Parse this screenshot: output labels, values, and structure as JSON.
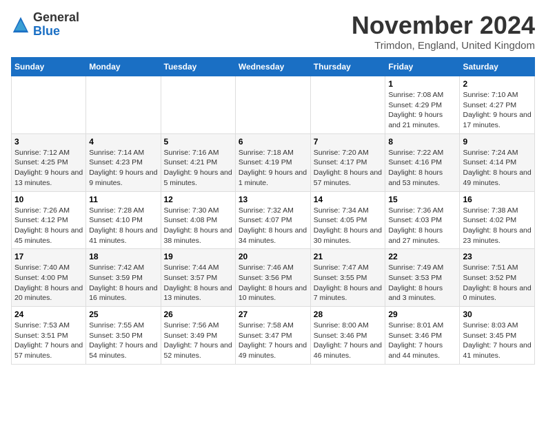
{
  "logo": {
    "general": "General",
    "blue": "Blue"
  },
  "header": {
    "month_title": "November 2024",
    "subtitle": "Trimdon, England, United Kingdom"
  },
  "days_of_week": [
    "Sunday",
    "Monday",
    "Tuesday",
    "Wednesday",
    "Thursday",
    "Friday",
    "Saturday"
  ],
  "weeks": [
    [
      {
        "day": "",
        "info": ""
      },
      {
        "day": "",
        "info": ""
      },
      {
        "day": "",
        "info": ""
      },
      {
        "day": "",
        "info": ""
      },
      {
        "day": "",
        "info": ""
      },
      {
        "day": "1",
        "info": "Sunrise: 7:08 AM\nSunset: 4:29 PM\nDaylight: 9 hours and 21 minutes."
      },
      {
        "day": "2",
        "info": "Sunrise: 7:10 AM\nSunset: 4:27 PM\nDaylight: 9 hours and 17 minutes."
      }
    ],
    [
      {
        "day": "3",
        "info": "Sunrise: 7:12 AM\nSunset: 4:25 PM\nDaylight: 9 hours and 13 minutes."
      },
      {
        "day": "4",
        "info": "Sunrise: 7:14 AM\nSunset: 4:23 PM\nDaylight: 9 hours and 9 minutes."
      },
      {
        "day": "5",
        "info": "Sunrise: 7:16 AM\nSunset: 4:21 PM\nDaylight: 9 hours and 5 minutes."
      },
      {
        "day": "6",
        "info": "Sunrise: 7:18 AM\nSunset: 4:19 PM\nDaylight: 9 hours and 1 minute."
      },
      {
        "day": "7",
        "info": "Sunrise: 7:20 AM\nSunset: 4:17 PM\nDaylight: 8 hours and 57 minutes."
      },
      {
        "day": "8",
        "info": "Sunrise: 7:22 AM\nSunset: 4:16 PM\nDaylight: 8 hours and 53 minutes."
      },
      {
        "day": "9",
        "info": "Sunrise: 7:24 AM\nSunset: 4:14 PM\nDaylight: 8 hours and 49 minutes."
      }
    ],
    [
      {
        "day": "10",
        "info": "Sunrise: 7:26 AM\nSunset: 4:12 PM\nDaylight: 8 hours and 45 minutes."
      },
      {
        "day": "11",
        "info": "Sunrise: 7:28 AM\nSunset: 4:10 PM\nDaylight: 8 hours and 41 minutes."
      },
      {
        "day": "12",
        "info": "Sunrise: 7:30 AM\nSunset: 4:08 PM\nDaylight: 8 hours and 38 minutes."
      },
      {
        "day": "13",
        "info": "Sunrise: 7:32 AM\nSunset: 4:07 PM\nDaylight: 8 hours and 34 minutes."
      },
      {
        "day": "14",
        "info": "Sunrise: 7:34 AM\nSunset: 4:05 PM\nDaylight: 8 hours and 30 minutes."
      },
      {
        "day": "15",
        "info": "Sunrise: 7:36 AM\nSunset: 4:03 PM\nDaylight: 8 hours and 27 minutes."
      },
      {
        "day": "16",
        "info": "Sunrise: 7:38 AM\nSunset: 4:02 PM\nDaylight: 8 hours and 23 minutes."
      }
    ],
    [
      {
        "day": "17",
        "info": "Sunrise: 7:40 AM\nSunset: 4:00 PM\nDaylight: 8 hours and 20 minutes."
      },
      {
        "day": "18",
        "info": "Sunrise: 7:42 AM\nSunset: 3:59 PM\nDaylight: 8 hours and 16 minutes."
      },
      {
        "day": "19",
        "info": "Sunrise: 7:44 AM\nSunset: 3:57 PM\nDaylight: 8 hours and 13 minutes."
      },
      {
        "day": "20",
        "info": "Sunrise: 7:46 AM\nSunset: 3:56 PM\nDaylight: 8 hours and 10 minutes."
      },
      {
        "day": "21",
        "info": "Sunrise: 7:47 AM\nSunset: 3:55 PM\nDaylight: 8 hours and 7 minutes."
      },
      {
        "day": "22",
        "info": "Sunrise: 7:49 AM\nSunset: 3:53 PM\nDaylight: 8 hours and 3 minutes."
      },
      {
        "day": "23",
        "info": "Sunrise: 7:51 AM\nSunset: 3:52 PM\nDaylight: 8 hours and 0 minutes."
      }
    ],
    [
      {
        "day": "24",
        "info": "Sunrise: 7:53 AM\nSunset: 3:51 PM\nDaylight: 7 hours and 57 minutes."
      },
      {
        "day": "25",
        "info": "Sunrise: 7:55 AM\nSunset: 3:50 PM\nDaylight: 7 hours and 54 minutes."
      },
      {
        "day": "26",
        "info": "Sunrise: 7:56 AM\nSunset: 3:49 PM\nDaylight: 7 hours and 52 minutes."
      },
      {
        "day": "27",
        "info": "Sunrise: 7:58 AM\nSunset: 3:47 PM\nDaylight: 7 hours and 49 minutes."
      },
      {
        "day": "28",
        "info": "Sunrise: 8:00 AM\nSunset: 3:46 PM\nDaylight: 7 hours and 46 minutes."
      },
      {
        "day": "29",
        "info": "Sunrise: 8:01 AM\nSunset: 3:46 PM\nDaylight: 7 hours and 44 minutes."
      },
      {
        "day": "30",
        "info": "Sunrise: 8:03 AM\nSunset: 3:45 PM\nDaylight: 7 hours and 41 minutes."
      }
    ]
  ]
}
